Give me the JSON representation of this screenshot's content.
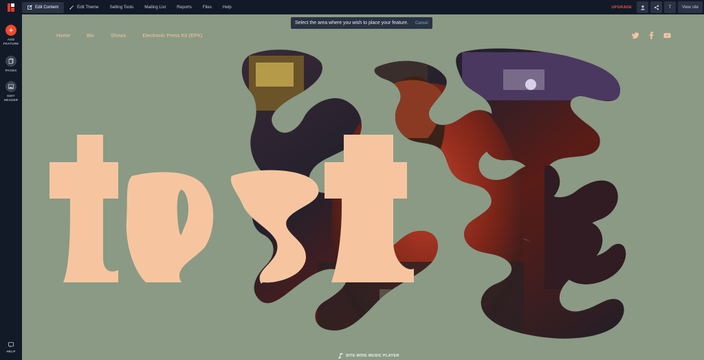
{
  "topbar": {
    "menu": [
      {
        "label": "Edit Content",
        "active": true,
        "icon": "edit-icon"
      },
      {
        "label": "Edit Theme",
        "active": false,
        "icon": "brush-icon"
      },
      {
        "label": "Selling Tools",
        "active": false
      },
      {
        "label": "Mailing List",
        "active": false
      },
      {
        "label": "Reports",
        "active": false
      },
      {
        "label": "Files",
        "active": false
      },
      {
        "label": "Help",
        "active": false
      }
    ],
    "upgrade_label": "UPGRADE",
    "tool_t_label": "T",
    "view_site_label": "View site"
  },
  "sidebar": {
    "add_feature_label": "ADD FEATURE",
    "pages_label": "PAGES",
    "edit_header_label": "EDIT HEADER",
    "help_label": "HELP"
  },
  "notice": {
    "message": "Select the area where you wish to place your feature.",
    "cancel_label": "Cancel"
  },
  "site": {
    "nav": [
      "Home",
      "Bio",
      "Shows",
      "Electronic Press Kit (EPK)"
    ],
    "socials": [
      "twitter-icon",
      "facebook-icon",
      "youtube-icon"
    ],
    "hero_title": "test",
    "player_label": "SITE-WIDE MUSIC PLAYER"
  },
  "colors": {
    "background": "#8a9a85",
    "title": "#f6c5a0",
    "accent": "#f0492a",
    "toolbar": "#121a28"
  }
}
